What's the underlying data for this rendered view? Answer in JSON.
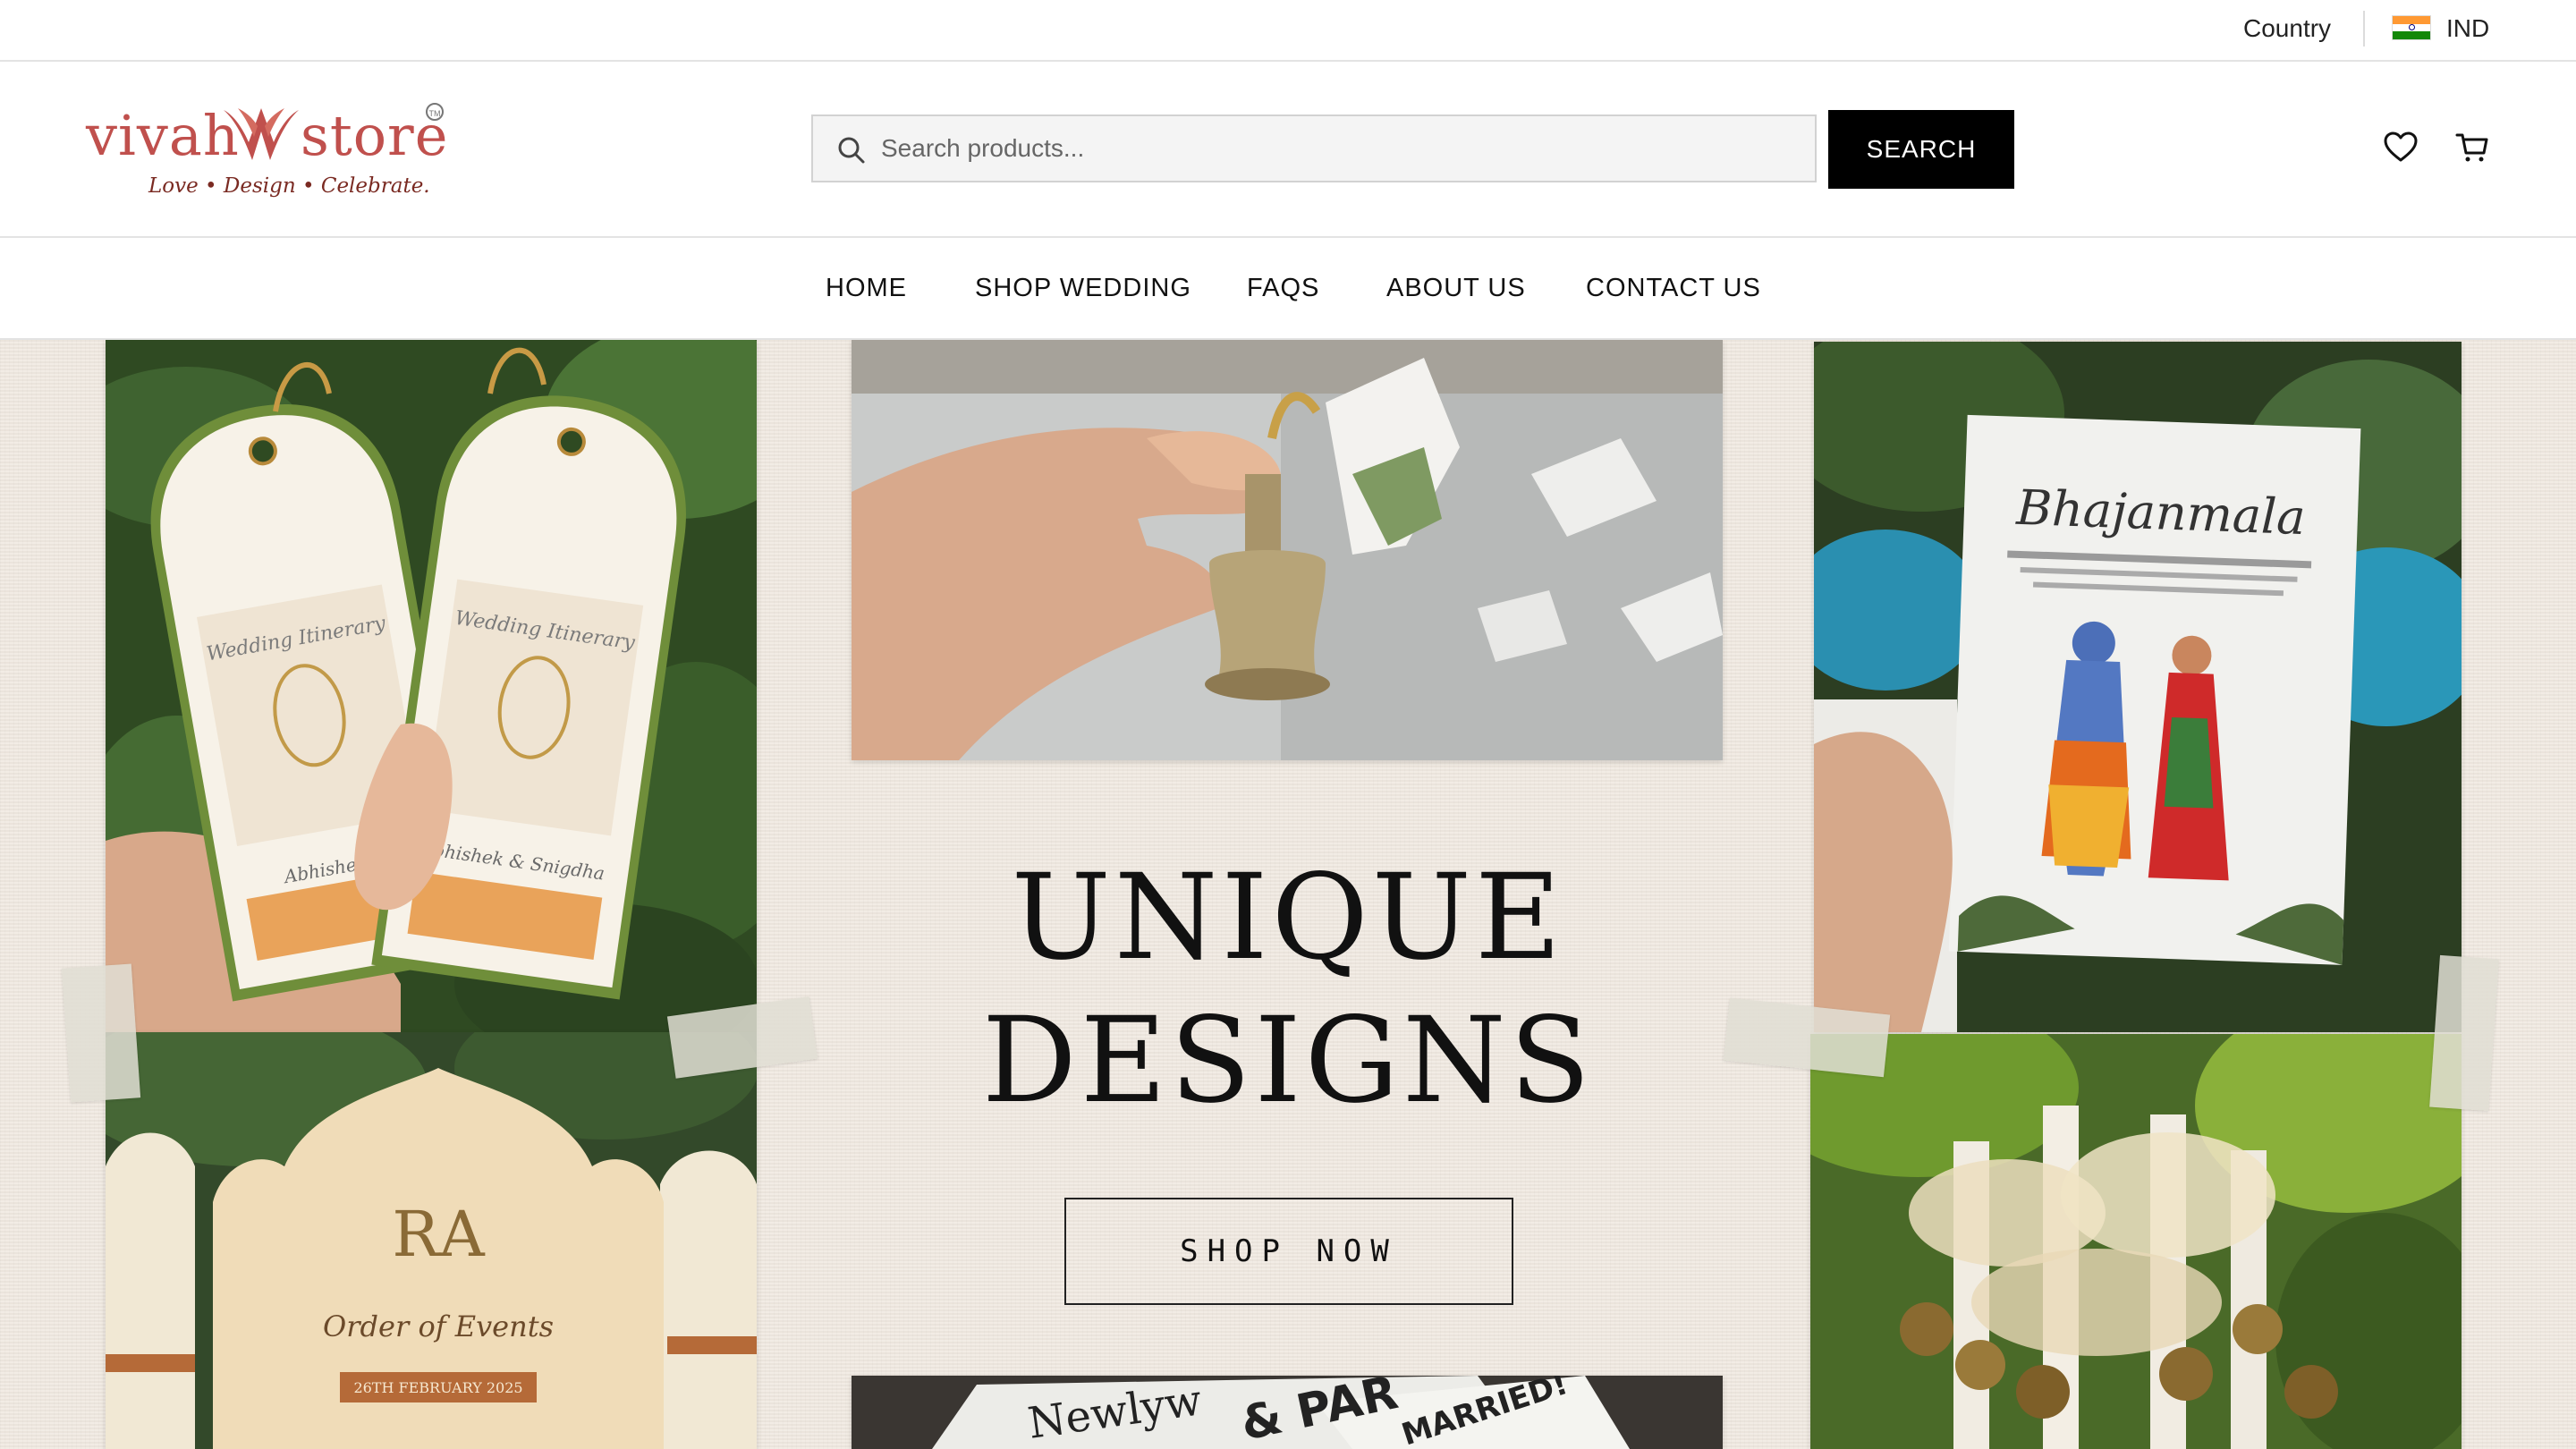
{
  "topbar": {
    "country_label": "Country",
    "country_code": "IND",
    "flag_icon": "india-flag-icon"
  },
  "brand": {
    "word1": "vivah",
    "word2": "store",
    "tagline": "Love • Design • Celebrate.",
    "trademark": "TM",
    "color": "#c0504d"
  },
  "search": {
    "placeholder": "Search products...",
    "value": "",
    "button_label": "SEARCH"
  },
  "header_icons": {
    "wishlist": "heart-icon",
    "cart": "cart-icon"
  },
  "nav": {
    "items": [
      {
        "label": "HOME"
      },
      {
        "label": "SHOP WEDDING"
      },
      {
        "label": "FAQS"
      },
      {
        "label": "ABOUT US"
      },
      {
        "label": "CONTACT US"
      }
    ]
  },
  "hero": {
    "title_line1": "UNIQUE",
    "title_line2": "DESIGNS",
    "cta_label": "SHOP NOW",
    "photos": {
      "itinerary": {
        "line1": "Wedding Itinerary",
        "names": "Abhishek & Snigdha"
      },
      "bhajanmala": {
        "title": "Bhajanmala"
      },
      "order_of_events": {
        "title": "Order of Events",
        "date": "26TH FEBRUARY 2025"
      },
      "newspaper": {
        "headline": "& PAR",
        "subhead": "MARRIED!"
      }
    }
  }
}
